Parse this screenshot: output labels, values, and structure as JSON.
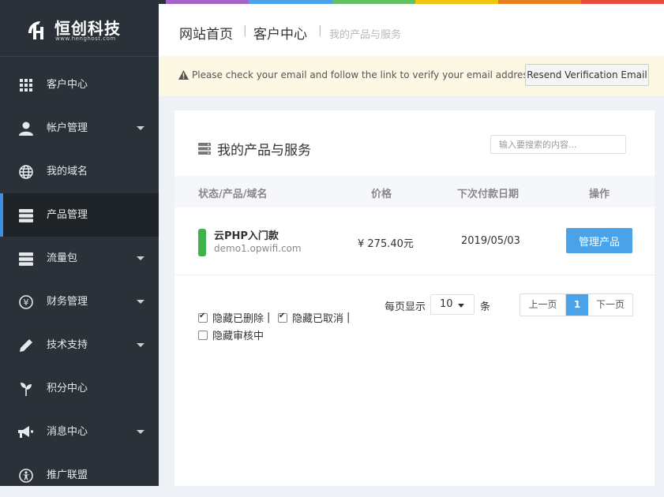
{
  "topbar": {
    "colors": [
      "#2b3138",
      "#2b3138",
      "#a463c6",
      "#4aa3e8",
      "#63c163",
      "#f1c40f",
      "#e67e22",
      "#e74c3c"
    ]
  },
  "logo": {
    "brand": "恒创科技",
    "url": "www.henghost.com",
    "mark_icon": "hengchuang-logo-icon"
  },
  "sidebar": {
    "items": [
      {
        "label": "客户中心",
        "icon": "grid-icon",
        "has_submenu": false,
        "active": false
      },
      {
        "label": "帐户管理",
        "icon": "user-icon",
        "has_submenu": true,
        "active": false
      },
      {
        "label": "我的域名",
        "icon": "globe-icon",
        "has_submenu": false,
        "active": false
      },
      {
        "label": "产品管理",
        "icon": "server-icon",
        "has_submenu": false,
        "active": true
      },
      {
        "label": "流量包",
        "icon": "server-icon",
        "has_submenu": true,
        "active": false
      },
      {
        "label": "财务管理",
        "icon": "yen-icon",
        "has_submenu": true,
        "active": false
      },
      {
        "label": "技术支持",
        "icon": "pencil-icon",
        "has_submenu": true,
        "active": false
      },
      {
        "label": "积分中心",
        "icon": "leaf-icon",
        "has_submenu": false,
        "active": false
      },
      {
        "label": "消息中心",
        "icon": "megaphone-icon",
        "has_submenu": true,
        "active": false
      },
      {
        "label": "推广联盟",
        "icon": "accessibility-icon",
        "has_submenu": false,
        "active": false
      }
    ]
  },
  "header": {
    "breadcrumb": [
      "网站首页",
      "客户中心"
    ],
    "current": "我的产品与服务",
    "separator": "|"
  },
  "alert": {
    "message": "Please check your email and follow the link to verify your email address.",
    "button": "Resend Verification Email",
    "icon": "warning-icon"
  },
  "card": {
    "title": "我的产品与服务",
    "title_icon": "server-icon",
    "search_placeholder": "输入要搜索的内容...",
    "columns": [
      "状态/产品/域名",
      "价格",
      "下次付款日期",
      "操作"
    ],
    "rows": [
      {
        "product": "云PHP入门款",
        "domain": "demo1.opwifi.com",
        "price": "¥ 275.40元",
        "next_due": "2019/05/03",
        "action": "管理产品",
        "status_color": "#3fb24c"
      }
    ],
    "filters": [
      {
        "label": "隐藏已删除",
        "checked": true
      },
      {
        "label": "隐藏已取消",
        "checked": true
      },
      {
        "label": "隐藏审核中",
        "checked": false
      }
    ],
    "filter_separator": "|",
    "per_page_label": "每页显示",
    "per_page_value": "10",
    "per_page_unit": "条",
    "pager": {
      "prev": "上一页",
      "page": "1",
      "next": "下一页"
    }
  }
}
